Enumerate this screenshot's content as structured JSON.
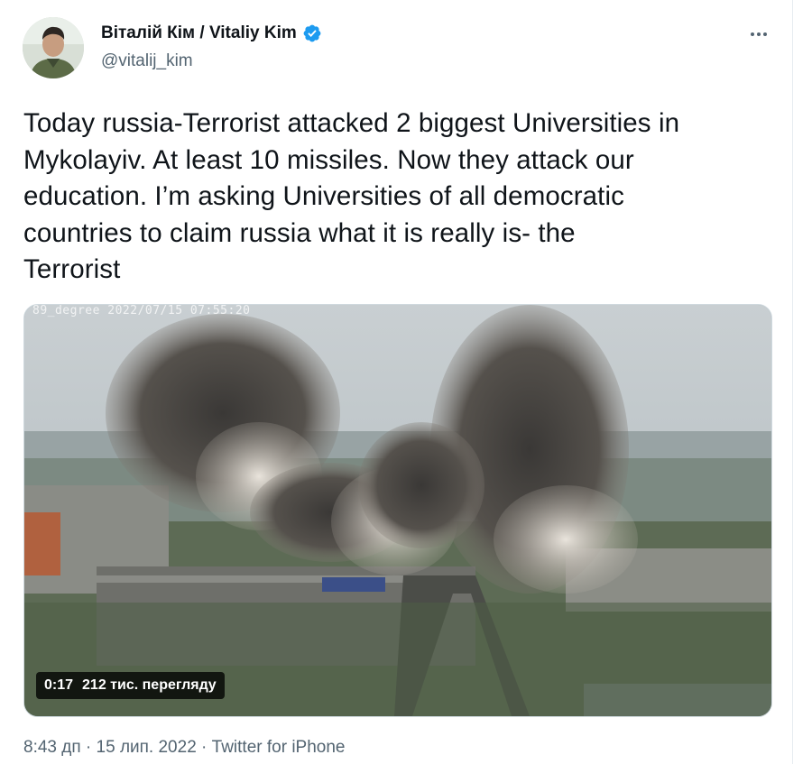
{
  "author": {
    "display_name": "Віталій Кім / Vitaliy Kim",
    "handle": "@vitalij_kim",
    "verified": true,
    "avatar_icon": "profile-photo"
  },
  "tweet": {
    "text": "Today russia-Terrorist attacked 2 biggest Universities in\nMykolayiv. At least 10 missiles. Now they attack our\neducation. I’m asking Universities of all democratic\ncountries to claim russia what it is really is- the\nTerrorist"
  },
  "media": {
    "type": "video",
    "duration": "0:17",
    "views": "212 тис. переглядy",
    "watermark": "89_degree 2022/07/15 07:55:20"
  },
  "meta": {
    "time": "8:43 дп",
    "separator": "·",
    "date": "15 лип. 2022",
    "source": "Twitter for iPhone"
  },
  "colors": {
    "text_primary": "#0f1419",
    "text_secondary": "#536471",
    "verified_blue": "#1d9bf0",
    "border": "#cfd9de"
  }
}
